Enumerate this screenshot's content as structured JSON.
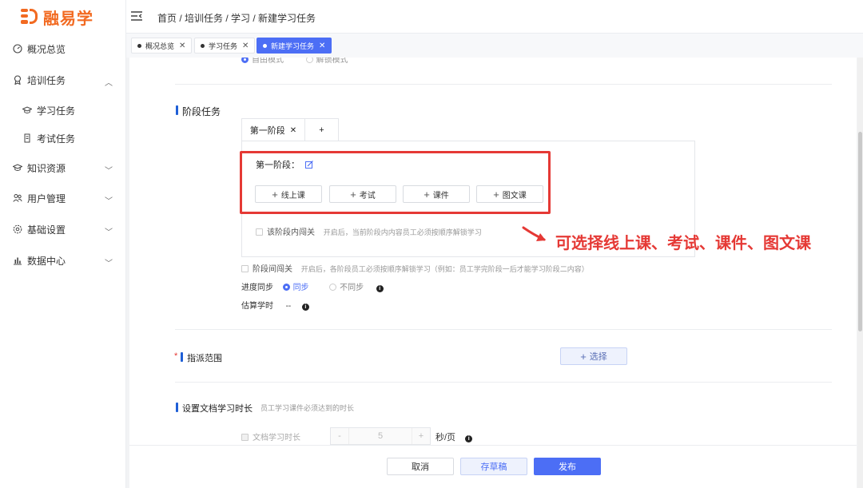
{
  "brand": {
    "name": "融易学",
    "color": "#f26a21"
  },
  "header": {
    "breadcrumb": "首页 / 培训任务 / 学习 / 新建学习任务"
  },
  "sidebar": {
    "items": [
      {
        "label": "概况总览",
        "icon": "dashboard-icon"
      },
      {
        "label": "培训任务",
        "icon": "award-icon",
        "expanded": true
      },
      {
        "label": "学习任务",
        "icon": "graduation-cap-icon"
      },
      {
        "label": "考试任务",
        "icon": "document-icon"
      },
      {
        "label": "知识资源",
        "icon": "graduation-cap-icon"
      },
      {
        "label": "用户管理",
        "icon": "users-icon"
      },
      {
        "label": "基础设置",
        "icon": "settings-icon"
      },
      {
        "label": "数据中心",
        "icon": "bar-chart-icon"
      }
    ]
  },
  "tabs": [
    {
      "label": "概况总览",
      "active": false
    },
    {
      "label": "学习任务",
      "active": false
    },
    {
      "label": "新建学习任务",
      "active": true
    }
  ],
  "form": {
    "mode_options": [
      "自由模式",
      "解锁模式"
    ],
    "stage_section": {
      "title": "阶段任务",
      "stage_tabs": [
        "第一阶段",
        "+"
      ],
      "stage_label": "第一阶段：",
      "add_buttons": [
        "线上课",
        "考试",
        "课件",
        "图文课"
      ],
      "inner_lock_label": "该阶段内闯关",
      "inner_lock_hint": "开启后，当前阶段内内容员工必须按顺序解锁学习",
      "between_lock_label": "阶段间闯关",
      "between_lock_hint": "开启后，各阶段员工必须按顺序解锁学习（例如：员工学完阶段一后才能学习阶段二内容）",
      "progress_sync_label": "进度同步",
      "progress_sync_options": [
        "同步",
        "不同步"
      ],
      "progress_sync_selected": "同步",
      "estimate_label": "估算学时",
      "estimate_value": "--"
    },
    "assign_section": {
      "required_mark": "*",
      "title": "指派范围",
      "select_button": "选择"
    },
    "doc_duration_section": {
      "title": "设置文档学习时长",
      "hint": "员工学习课件必须达到的时长",
      "checkbox_label": "文档学习时长",
      "value": "5",
      "unit": "秒/页",
      "minus": "-",
      "plus": "+"
    }
  },
  "footer": {
    "cancel": "取消",
    "draft": "存草稿",
    "publish": "发布"
  },
  "annotation": {
    "text": "可选择线上课、考试、课件、图文课",
    "color": "#e53935"
  },
  "colors": {
    "primary": "#4c6ef5",
    "section_bar": "#1f5fd6"
  }
}
